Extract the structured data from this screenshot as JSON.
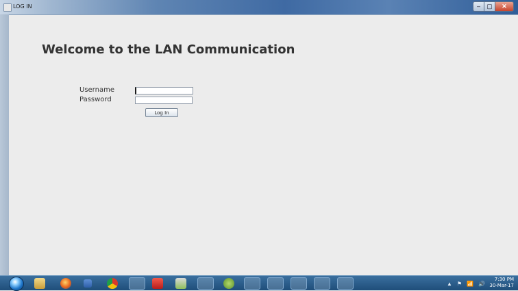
{
  "window": {
    "title": "LOG IN",
    "buttons": {
      "minimize": "–",
      "maximize": "▢",
      "close": "✕"
    }
  },
  "main": {
    "heading": "Welcome to the LAN Communication",
    "username_label": "Username",
    "password_label": "Password",
    "username_value": "",
    "password_value": "",
    "login_button": "Log In"
  },
  "taskbar": {
    "apps": [
      "start-orb",
      "file-explorer-icon",
      "firefox-icon",
      "media-player-icon",
      "chrome-icon",
      "app-icon",
      "app-icon",
      "app-icon",
      "chrome-icon",
      "android-icon",
      "app-icon",
      "java-icon",
      "app-icon",
      "java-icon",
      "java-icon"
    ],
    "tray": {
      "up_arrow": "▲",
      "flag": "⚑",
      "signal": "📶",
      "volume": "🔊"
    },
    "time": "7:30 PM",
    "date": "30-Mar-17"
  }
}
